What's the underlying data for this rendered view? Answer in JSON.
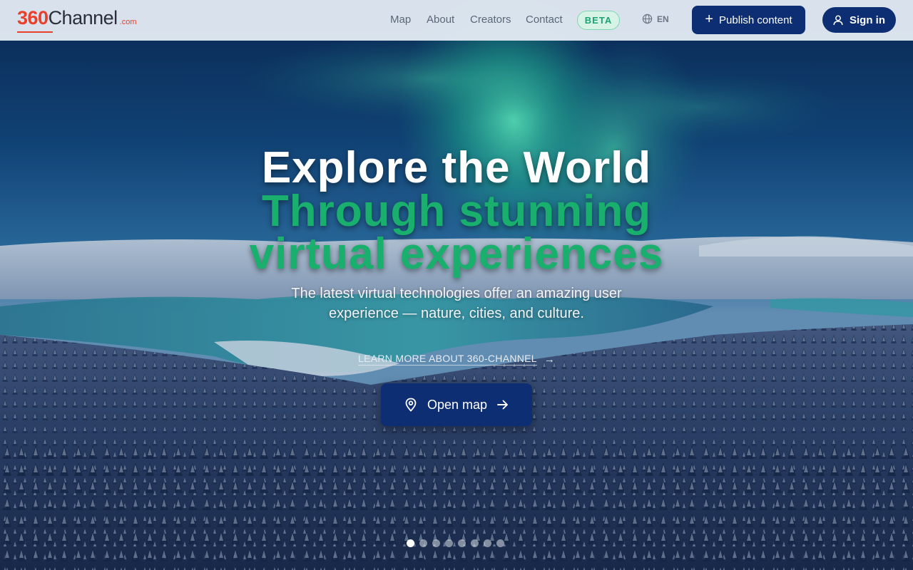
{
  "header": {
    "logo": {
      "number": "360",
      "word": "Channel",
      "tld": ".com"
    },
    "nav": [
      {
        "label": "Map"
      },
      {
        "label": "About"
      },
      {
        "label": "Creators"
      },
      {
        "label": "Contact"
      }
    ],
    "beta_badge": "BETA",
    "language": {
      "icon": "globe-icon",
      "code": "EN"
    },
    "publish_button": {
      "icon": "plus-icon",
      "label": "Publish content"
    },
    "signin_button": {
      "icon": "user-icon",
      "label": "Sign in"
    }
  },
  "hero": {
    "headline_line1": "Explore the World",
    "headline_line2": "Through stunning",
    "headline_line3": "virtual experiences",
    "subtitle": "The latest virtual technologies offer an amazing user experience — nature, cities, and culture.",
    "learn_more": {
      "label": "LEARN MORE ABOUT 360-CHANNEL",
      "icon": "arrow-right-icon"
    },
    "open_map_button": {
      "label": "Open map",
      "icon_left": "map-pin-icon",
      "icon_right": "arrow-right-icon"
    },
    "carousel": {
      "total": 8,
      "active_index": 0
    }
  },
  "colors": {
    "brand_red": "#e9402b",
    "primary_navy": "#0d2e73",
    "accent_green": "#19b06e",
    "header_bg": "#e2eaf2"
  }
}
